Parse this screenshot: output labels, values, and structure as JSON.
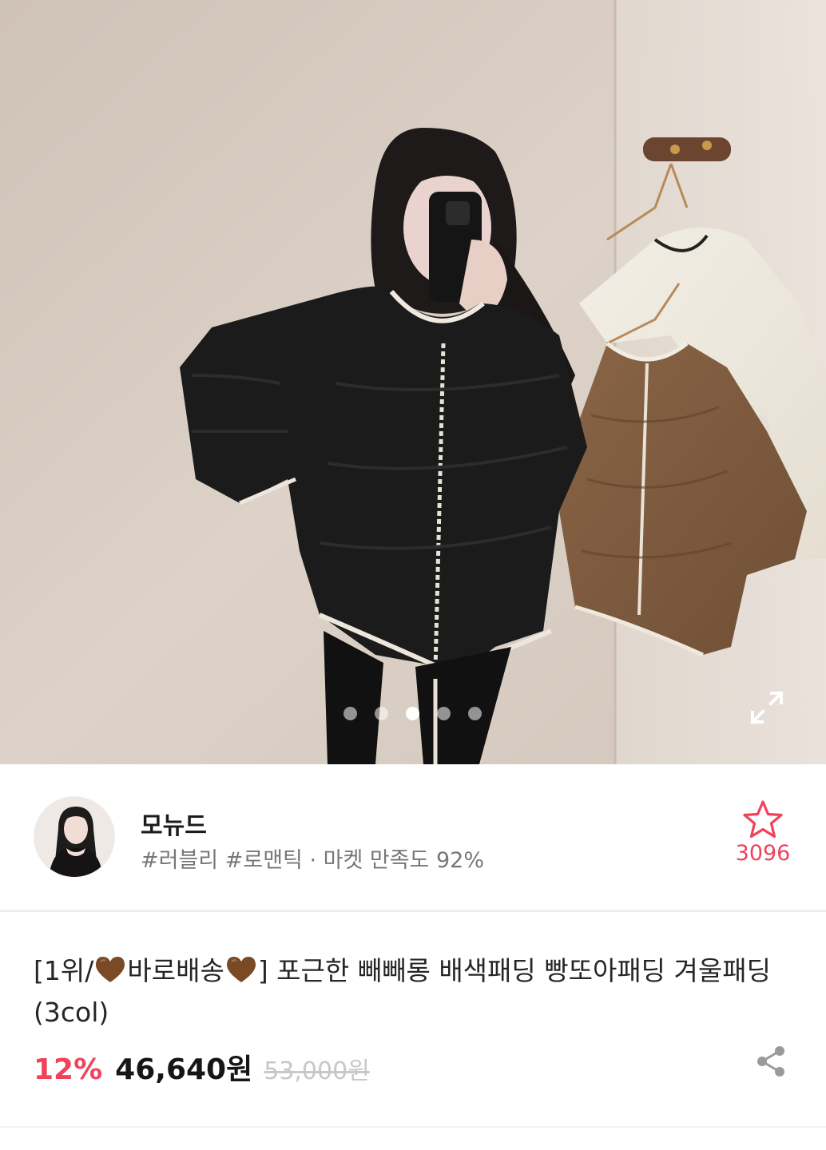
{
  "gallery": {
    "image_alt": "product-photo-black-padding-jacket",
    "dots_total": 5,
    "dots_active_index": 2,
    "expand_icon": "expand-icon"
  },
  "seller": {
    "name": "모뉴드",
    "tags": "#러블리 #로맨틱 · 마켓 만족도 92%",
    "favorite_count": "3096",
    "favorite_icon": "star-outline-icon",
    "accent_color": "#f1425a"
  },
  "product": {
    "title_parts": {
      "p1": "[1위/",
      "p2": "바로배송",
      "p3": "] 포근한 빼빼롱 배색패딩 빵또아패딩 겨울패딩 (3col)"
    },
    "discount": "12%",
    "price": "46,640원",
    "original_price": "53,000원",
    "share_icon": "share-icon"
  }
}
